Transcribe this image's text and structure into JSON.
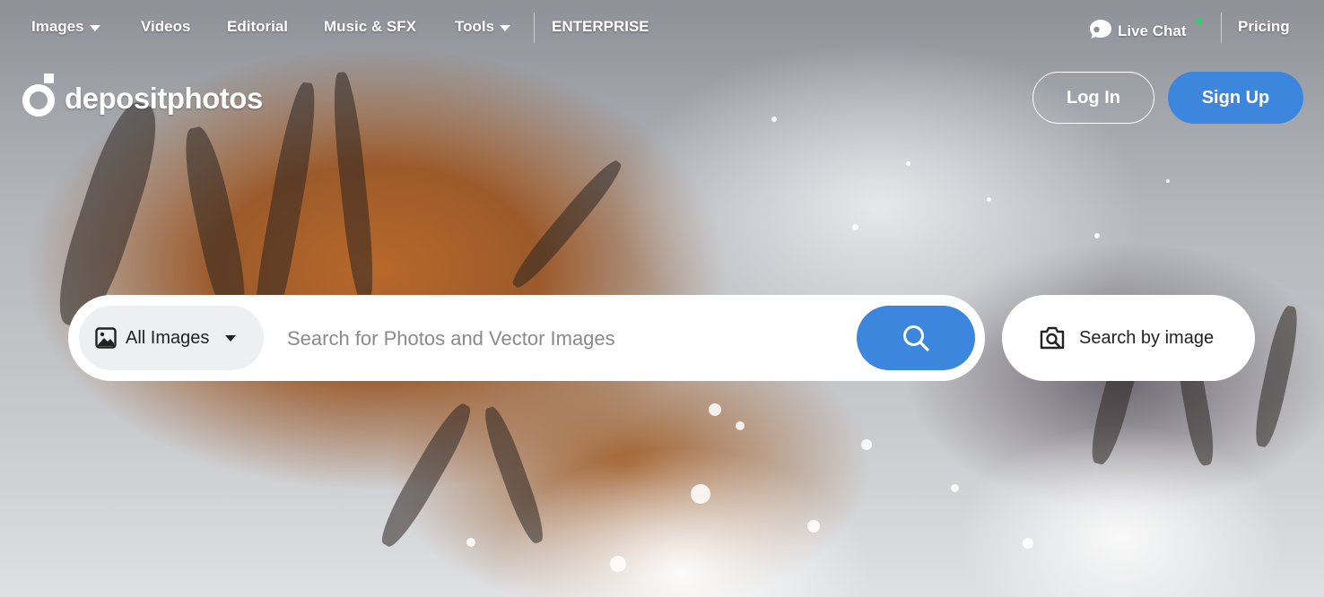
{
  "nav": {
    "images": "Images",
    "videos": "Videos",
    "editorial": "Editorial",
    "music": "Music & SFX",
    "tools": "Tools",
    "enterprise": "ENTERPRISE",
    "live_chat": "Live Chat",
    "pricing": "Pricing"
  },
  "brand": {
    "name": "depositphotos"
  },
  "auth": {
    "login": "Log In",
    "signup": "Sign Up"
  },
  "search": {
    "type_label": "All Images",
    "placeholder": "Search for Photos and Vector Images",
    "value": "",
    "image_search_label": "Search by image"
  },
  "colors": {
    "accent": "#3d86de",
    "online": "#27d36b"
  },
  "icons": {
    "search": "search-icon",
    "image_type": "image-icon",
    "camera_search": "camera-search-icon",
    "chat": "chat-bubble-icon",
    "logo": "depositphotos-logo-icon"
  }
}
